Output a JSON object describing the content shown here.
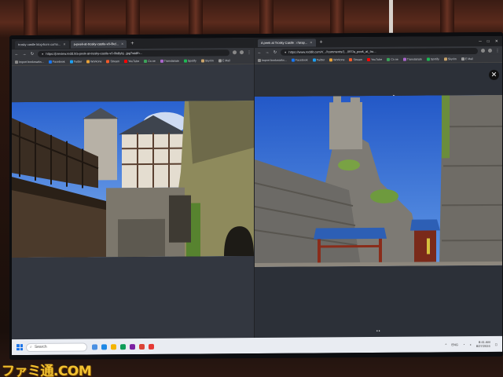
{
  "left_browser": {
    "tabs": [
      {
        "label": "trosky castle klog-born como...",
        "active": false
      },
      {
        "label": "a-peek-at-trosky-castle-v0-0kd...",
        "active": true
      }
    ],
    "url": "https://preview.redd.it/a-peek-at-trosky-castle-v0-0kdlyhj...jpg?width...",
    "bookmarks": [
      "Import bookmarks...",
      "Facebook",
      "Twitter",
      "Workone",
      "Stream",
      "YouTube",
      "Co.ne",
      "Translatrate",
      "Spotify",
      "Skyrim",
      "E Mail"
    ]
  },
  "right_browser": {
    "tabs": [
      {
        "label": "A peek at Trosky Castle : r/arap...",
        "active": true
      }
    ],
    "url": "https://www.reddit.com/r/...//comments/1...097/a_peek_at_tro...",
    "bookmarks": [
      "Import bookmarks...",
      "Facebook",
      "Twitter",
      "Workone",
      "Stream",
      "YouTube",
      "Co.ne",
      "Translatrate",
      "Spotify",
      "Skyrim",
      "E Mail"
    ],
    "close_symbol": "✕",
    "pager": "••"
  },
  "taskbar": {
    "search_placeholder": "Search",
    "tray_lang": "ENG",
    "time": "8:41 AM",
    "date": "8/27/2024"
  },
  "watermark": "ファミ通.COM",
  "colors": {
    "sky": "#2f6fd8",
    "stone": "#6f6a63",
    "grass": "#6c8f3a",
    "tile_roof": "#2d5fb5",
    "watermark": "#f2c230"
  }
}
